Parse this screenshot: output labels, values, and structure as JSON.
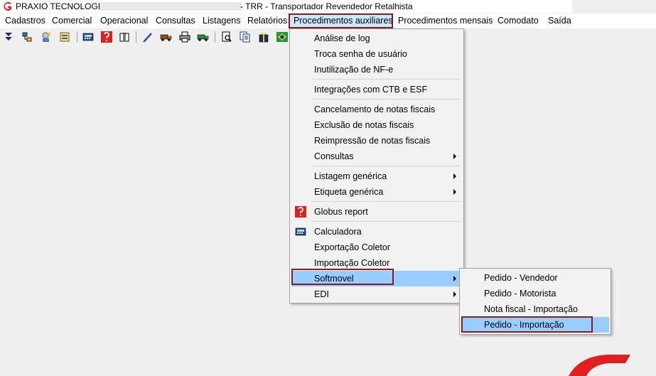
{
  "titlebar": {
    "app_name": "PRAXIO TECNOLOGIA",
    "window_title": "- TRR - Transportador Revendedor Retalhista"
  },
  "menubar": {
    "items": [
      {
        "label": "Cadastros"
      },
      {
        "label": "Comercial"
      },
      {
        "label": "Operacional"
      },
      {
        "label": "Consultas"
      },
      {
        "label": "Listagens"
      },
      {
        "label": "Relatórios"
      },
      {
        "label": "Procedimentos auxiliares",
        "active": true
      },
      {
        "label": "Procedimentos mensais"
      },
      {
        "label": "Comodato"
      },
      {
        "label": "Saída"
      }
    ]
  },
  "toolbar": {
    "buttons": [
      "arrow-down-icon",
      "network-icon",
      "wizard-icon",
      "document-icon",
      "calculator-icon",
      "globus-report-icon",
      "book-icon",
      "pen-icon",
      "truck-icon",
      "printer-icon",
      "truck-green-icon",
      "search-document-icon",
      "documents-icon",
      "gift-icon",
      "brazil-flag-icon"
    ]
  },
  "dropdown": {
    "items": [
      {
        "label": "Análise de log"
      },
      {
        "label": "Troca senha de usuário"
      },
      {
        "label": "Inutilização de NF-e"
      },
      {
        "label": "Integrações com CTB e ESF"
      },
      {
        "label": "Cancelamento de notas fiscais"
      },
      {
        "label": "Exclusão de notas fiscais"
      },
      {
        "label": "Reimpressão de notas fiscais"
      },
      {
        "label": "Consultas",
        "submenu": true
      },
      {
        "label": "Listagem genérica",
        "submenu": true
      },
      {
        "label": "Etiqueta genérica",
        "submenu": true
      },
      {
        "label": "Globus report",
        "icon": "globus-report-icon"
      },
      {
        "label": "Calculadora",
        "icon": "calculator-icon"
      },
      {
        "label": "Exportação Coletor"
      },
      {
        "label": "Importação Coletor"
      },
      {
        "label": "Softmovel",
        "submenu": true,
        "highlighted": true
      },
      {
        "label": "EDI",
        "submenu": true
      }
    ]
  },
  "submenu": {
    "items": [
      {
        "label": "Pedido - Vendedor"
      },
      {
        "label": "Pedido - Motorista"
      },
      {
        "label": "Nota fiscal - Importação"
      },
      {
        "label": "Pedido - Importação",
        "highlighted": true
      }
    ]
  },
  "colors": {
    "highlight_border": "#8b1a1a",
    "hover_bg": "#99ccff",
    "brand_red": "#e02020"
  }
}
